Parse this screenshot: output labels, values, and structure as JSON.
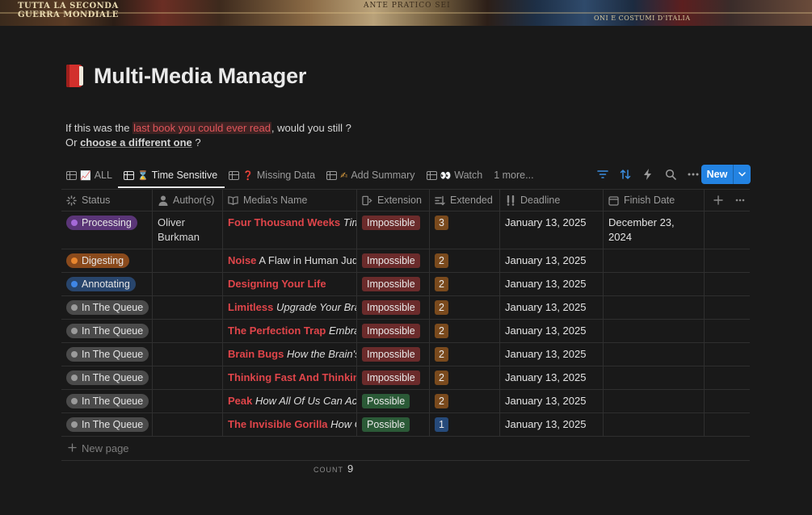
{
  "cover": {
    "text1": "TUTTA LA SECONDA",
    "text2": "GUERRA MONDIALE",
    "text3": "ANTE   PRATICO   SEI",
    "text4": "ONI E COSTUMI D'ITALIA"
  },
  "page": {
    "title": "Multi-Media Manager",
    "icon": "red-book-icon"
  },
  "quote": {
    "line1_prefix": "If this was the ",
    "line1_highlight": "last book you could ever read",
    "line1_suffix": ", would you still ?",
    "line2_prefix": "Or ",
    "line2_link": "choose a different one",
    "line2_suffix": " ?"
  },
  "tabs": [
    {
      "label": "ALL",
      "emoji": "📈"
    },
    {
      "label": "Time Sensitive",
      "emoji": "⌛"
    },
    {
      "label": "Missing Data",
      "emoji": "❓"
    },
    {
      "label": "Add Summary",
      "emoji": "✍"
    },
    {
      "label": "Watch",
      "emoji": "👀"
    }
  ],
  "more_tabs": "1 more...",
  "new_button": "New",
  "columns": [
    "Status",
    "Author(s)",
    "Media's Name",
    "Extension",
    "Extended",
    "Deadline",
    "Finish Date"
  ],
  "colors": {
    "processing": "#5a3577",
    "digesting": "#8a4a1c",
    "annotating": "#28456c",
    "queue": "#4a4a4a",
    "impossible": "#6b2b2b",
    "possible": "#2b5a37",
    "num_brown": "#7a4a1d",
    "num_blue": "#264a7a",
    "accent": "#2383e2"
  },
  "rows": [
    {
      "status": "Processing",
      "author": "Oliver Burkman",
      "title": "Four Thousand Weeks",
      "sub": "Time Management for Mortals",
      "ext": "Impossible",
      "num": "3",
      "deadline": "January 13, 2025",
      "finish": "December 23, 2024"
    },
    {
      "status": "Digesting",
      "author": "",
      "title": "Noise",
      "sub": "A Flaw in Human Judgment",
      "ext": "Impossible",
      "num": "2",
      "deadline": "January 13, 2025",
      "finish": ""
    },
    {
      "status": "Annotating",
      "author": "",
      "title": "Designing Your Life",
      "sub": "",
      "ext": "Impossible",
      "num": "2",
      "deadline": "January 13, 2025",
      "finish": ""
    },
    {
      "status": "In The Queue",
      "author": "",
      "title": "Limitless",
      "sub": "Upgrade Your Brain",
      "ext": "Impossible",
      "num": "2",
      "deadline": "January 13, 2025",
      "finish": ""
    },
    {
      "status": "In The Queue",
      "author": "",
      "title": "The Perfection Trap",
      "sub": "Embracing the Power of Good Enough",
      "ext": "Impossible",
      "num": "2",
      "deadline": "January 13, 2025",
      "finish": ""
    },
    {
      "status": "In The Queue",
      "author": "",
      "title": "Brain Bugs",
      "sub": "How the Brain's Flaws Shape Our Lives",
      "ext": "Impossible",
      "num": "2",
      "deadline": "January 13, 2025",
      "finish": ""
    },
    {
      "status": "In The Queue",
      "author": "",
      "title": "Thinking Fast And Thinking Slow",
      "sub": "",
      "ext": "Impossible",
      "num": "2",
      "deadline": "January 13, 2025",
      "finish": ""
    },
    {
      "status": "In The Queue",
      "author": "",
      "title": "Peak",
      "sub": "How All Of Us Can Achieve Extraordinary Things",
      "ext": "Possible",
      "num": "2",
      "deadline": "January 13, 2025",
      "finish": ""
    },
    {
      "status": "In The Queue",
      "author": "",
      "title": "The Invisible Gorilla",
      "sub": "How Our Intuitions Deceive Us",
      "ext": "Possible",
      "num": "1",
      "deadline": "January 13, 2025",
      "finish": ""
    }
  ],
  "new_page": "New page",
  "count": {
    "label": "COUNT",
    "value": "9"
  }
}
